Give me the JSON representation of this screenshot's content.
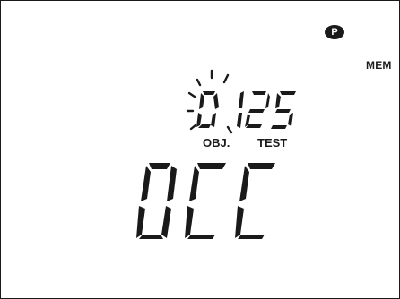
{
  "indicators": {
    "p_badge": "P",
    "mem": "MEM"
  },
  "object_display": {
    "value": "0",
    "label": "OBJ.",
    "blinking": true
  },
  "test_display": {
    "value": "125",
    "label": "TEST"
  },
  "main_display": {
    "text": "OCC"
  },
  "colors": {
    "segment": "#1a1a1a",
    "background": "#ffffff"
  }
}
